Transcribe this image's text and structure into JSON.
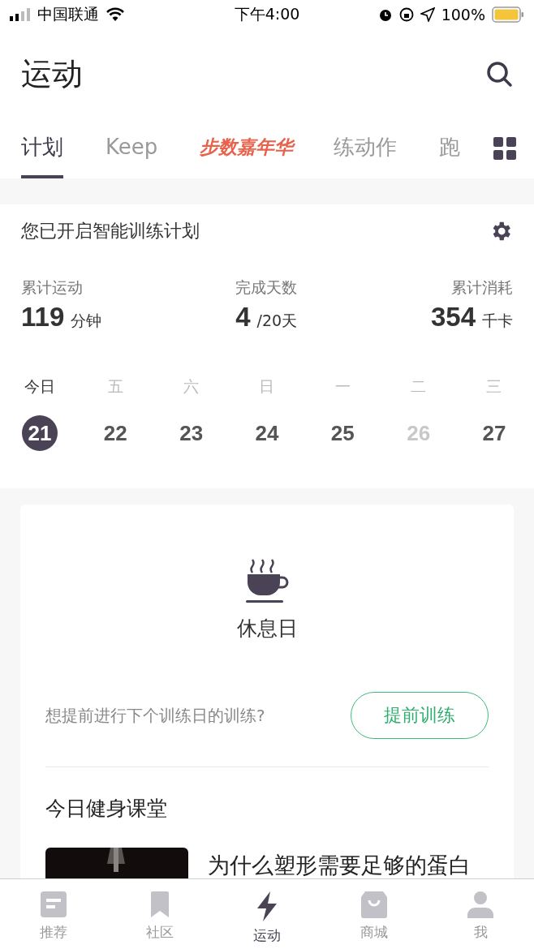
{
  "status_bar": {
    "carrier": "中国联通",
    "time": "下午4:00",
    "battery": "100%"
  },
  "header": {
    "title": "运动"
  },
  "tabs": [
    {
      "label": "计划",
      "selected": true,
      "kind": "text"
    },
    {
      "label": "Keep",
      "selected": false,
      "kind": "text"
    },
    {
      "label": "步数嘉年华",
      "selected": false,
      "kind": "promo"
    },
    {
      "label": "练动作",
      "selected": false,
      "kind": "text"
    },
    {
      "label": "跑",
      "selected": false,
      "kind": "text"
    }
  ],
  "plan": {
    "title": "您已开启智能训练计划",
    "stats": [
      {
        "label": "累计运动",
        "value": "119",
        "unit": "分钟"
      },
      {
        "label": "完成天数",
        "value": "4",
        "unit": "/20天"
      },
      {
        "label": "累计消耗",
        "value": "354",
        "unit": "千卡"
      }
    ],
    "days": [
      {
        "weekday": "今日",
        "date": "21",
        "selected": true,
        "dimmed": false
      },
      {
        "weekday": "五",
        "date": "22",
        "selected": false,
        "dimmed": false
      },
      {
        "weekday": "六",
        "date": "23",
        "selected": false,
        "dimmed": false
      },
      {
        "weekday": "日",
        "date": "24",
        "selected": false,
        "dimmed": false
      },
      {
        "weekday": "一",
        "date": "25",
        "selected": false,
        "dimmed": false
      },
      {
        "weekday": "二",
        "date": "26",
        "selected": false,
        "dimmed": true
      },
      {
        "weekday": "三",
        "date": "27",
        "selected": false,
        "dimmed": false
      }
    ]
  },
  "rest": {
    "title": "休息日",
    "prompt": "想提前进行下个训练日的训练?",
    "button": "提前训练"
  },
  "class": {
    "title": "今日健身课堂",
    "article_title": "为什么塑形需要足够的蛋白"
  },
  "bottom_nav": [
    {
      "label": "推荐",
      "selected": false
    },
    {
      "label": "社区",
      "selected": false
    },
    {
      "label": "运动",
      "selected": true
    },
    {
      "label": "商城",
      "selected": false
    },
    {
      "label": "我",
      "selected": false
    }
  ]
}
